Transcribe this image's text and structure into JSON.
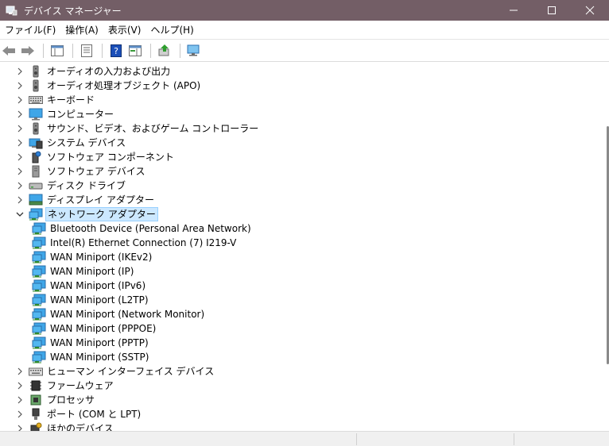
{
  "window": {
    "title": "デバイス マネージャー"
  },
  "menu": [
    "ファイル(F)",
    "操作(A)",
    "表示(V)",
    "ヘルプ(H)"
  ],
  "tree": [
    {
      "label": "オーディオの入力および出力",
      "icon": "speaker-icon",
      "expanded": false
    },
    {
      "label": "オーディオ処理オブジェクト (APO)",
      "icon": "speaker-icon",
      "expanded": false
    },
    {
      "label": "キーボード",
      "icon": "keyboard-icon",
      "expanded": false
    },
    {
      "label": "コンピューター",
      "icon": "computer-icon",
      "expanded": false
    },
    {
      "label": "サウンド、ビデオ、およびゲーム コントローラー",
      "icon": "speaker-icon",
      "expanded": false
    },
    {
      "label": "システム デバイス",
      "icon": "system-device-icon",
      "expanded": false
    },
    {
      "label": "ソフトウェア コンポーネント",
      "icon": "software-component-icon",
      "expanded": false
    },
    {
      "label": "ソフトウェア デバイス",
      "icon": "software-device-icon",
      "expanded": false
    },
    {
      "label": "ディスク ドライブ",
      "icon": "disk-drive-icon",
      "expanded": false
    },
    {
      "label": "ディスプレイ アダプター",
      "icon": "display-adapter-icon",
      "expanded": false
    },
    {
      "label": "ネットワーク アダプター",
      "icon": "network-adapter-icon",
      "expanded": true,
      "selected": true
    },
    {
      "label": "Bluetooth Device (Personal Area Network)",
      "icon": "network-adapter-icon",
      "child": true
    },
    {
      "label": "Intel(R) Ethernet Connection (7) I219-V",
      "icon": "network-adapter-icon",
      "child": true
    },
    {
      "label": "WAN Miniport (IKEv2)",
      "icon": "network-adapter-icon",
      "child": true
    },
    {
      "label": "WAN Miniport (IP)",
      "icon": "network-adapter-icon",
      "child": true
    },
    {
      "label": "WAN Miniport (IPv6)",
      "icon": "network-adapter-icon",
      "child": true
    },
    {
      "label": "WAN Miniport (L2TP)",
      "icon": "network-adapter-icon",
      "child": true
    },
    {
      "label": "WAN Miniport (Network Monitor)",
      "icon": "network-adapter-icon",
      "child": true
    },
    {
      "label": "WAN Miniport (PPPOE)",
      "icon": "network-adapter-icon",
      "child": true
    },
    {
      "label": "WAN Miniport (PPTP)",
      "icon": "network-adapter-icon",
      "child": true
    },
    {
      "label": "WAN Miniport (SSTP)",
      "icon": "network-adapter-icon",
      "child": true
    },
    {
      "label": "ヒューマン インターフェイス デバイス",
      "icon": "hid-icon",
      "expanded": false
    },
    {
      "label": "ファームウェア",
      "icon": "firmware-icon",
      "expanded": false
    },
    {
      "label": "プロセッサ",
      "icon": "processor-icon",
      "expanded": false
    },
    {
      "label": "ポート (COM と LPT)",
      "icon": "port-icon",
      "expanded": false
    },
    {
      "label": "ほかのデバイス",
      "icon": "other-device-icon",
      "expanded": false
    }
  ],
  "colors": {
    "titlebar": "#735e66",
    "selection": "#cce8ff",
    "selection_border": "#99d1ff"
  }
}
